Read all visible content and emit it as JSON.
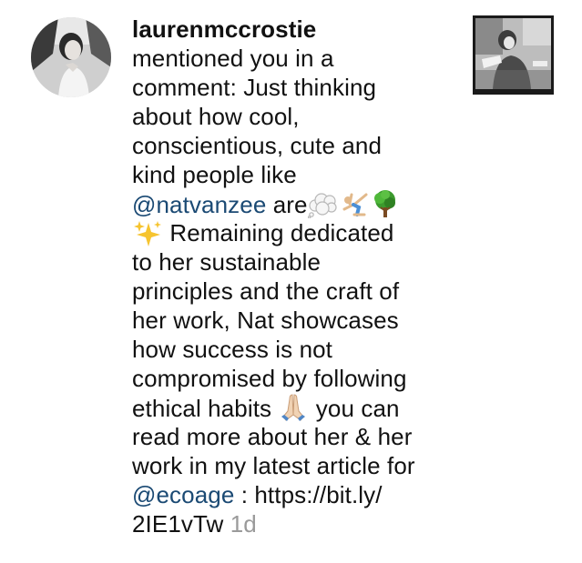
{
  "notification": {
    "username": "laurenmccrostie",
    "lines": [
      "mentioned you in a",
      "comment: Just thinking",
      "about how cool,",
      "conscientious, cute and",
      "kind people like"
    ],
    "mention_1": "@natvanzee",
    "after_mention_1": " are",
    "line_8_text": " Remaining dedicated",
    "lines_after": [
      "to her sustainable",
      "principles and the craft of",
      "her work, Nat showcases",
      "how success is not",
      "compromised by following"
    ],
    "line_14_text": "ethical habits ",
    "line_14_after": " you can",
    "line_15": "read more about her & her",
    "line_16": "work in my latest article for",
    "mention_2": "@ecoage",
    "after_mention_2": " : https://bit.ly/",
    "last_line": "2IE1vTw",
    "timestamp": "1d",
    "emojis": [
      "thought-balloon",
      "cartwheel",
      "deciduous-tree",
      "sparkles",
      "folded-hands"
    ]
  },
  "colors": {
    "mention": "#1b4a74",
    "timestamp": "#9a9a9a",
    "text": "#111111"
  }
}
